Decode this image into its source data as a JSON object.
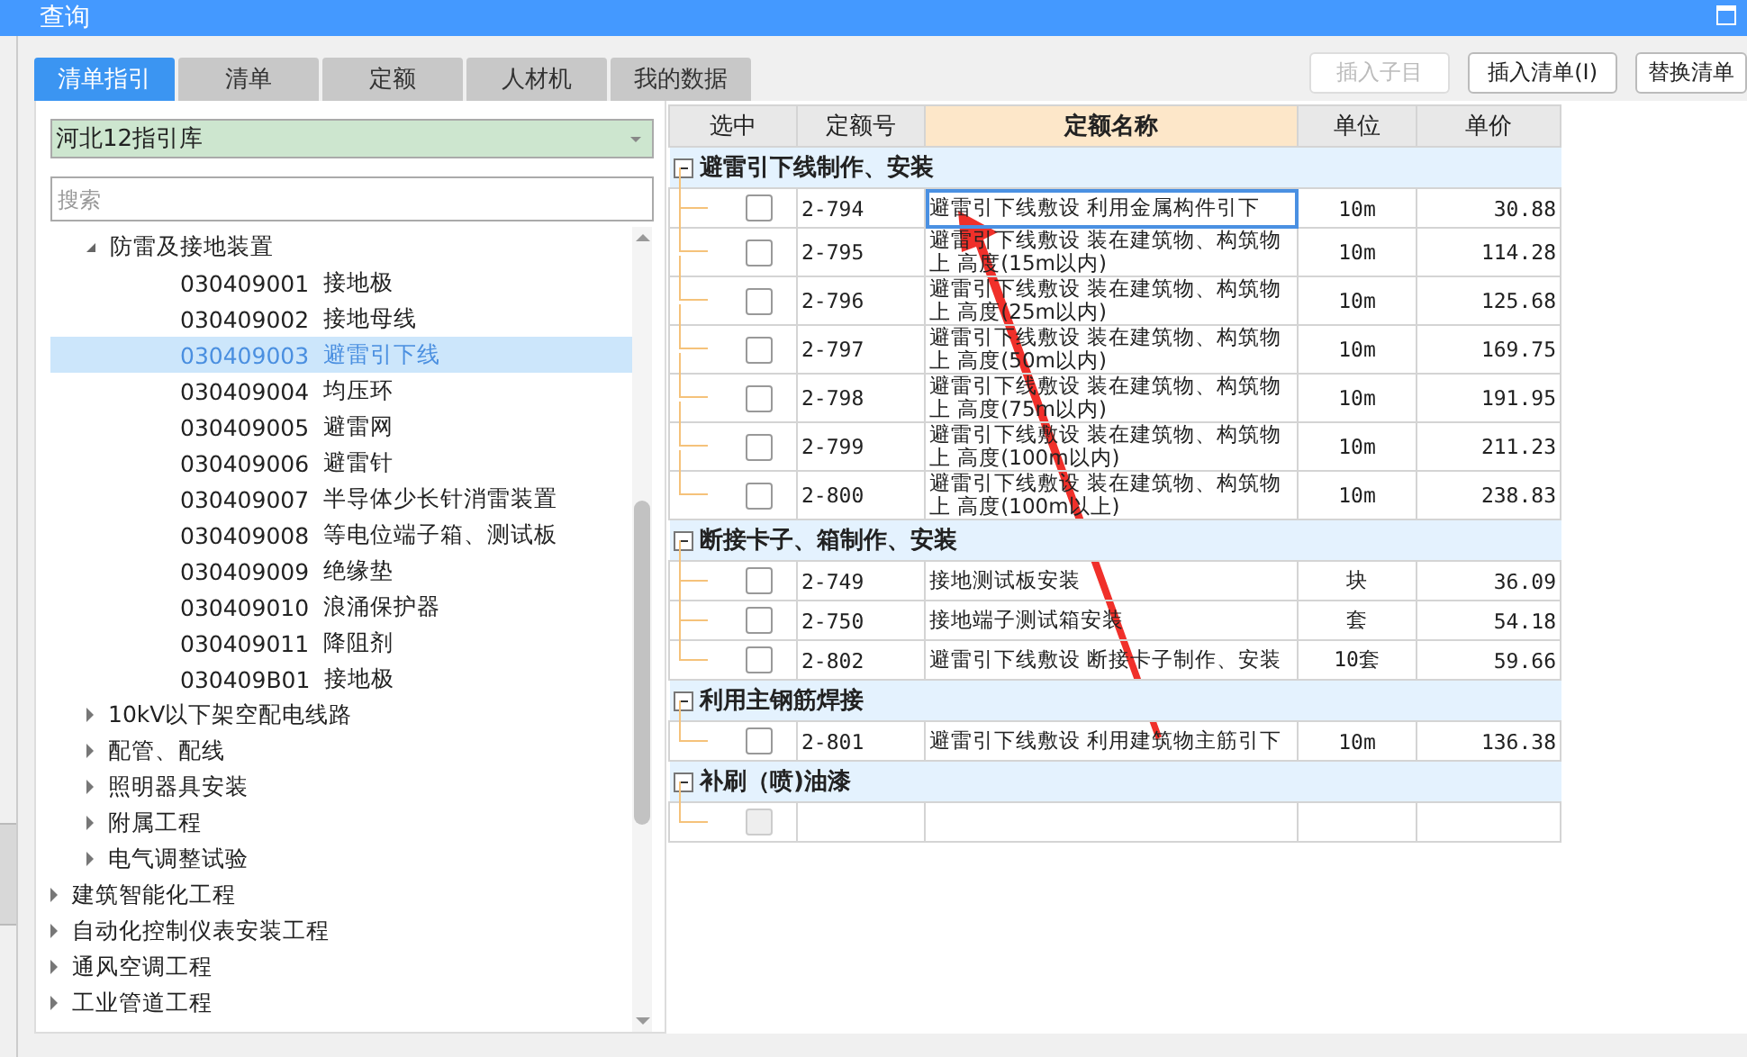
{
  "window": {
    "title": "查询"
  },
  "tabs": [
    {
      "label": "清单指引",
      "selected": true
    },
    {
      "label": "清单",
      "selected": false
    },
    {
      "label": "定额",
      "selected": false
    },
    {
      "label": "人材机",
      "selected": false
    },
    {
      "label": "我的数据",
      "selected": false
    }
  ],
  "buttons": [
    {
      "label": "插入子目",
      "disabled": true
    },
    {
      "label": "插入清单(I)",
      "disabled": false
    },
    {
      "label": "替换清单",
      "disabled": false
    }
  ],
  "library_select": {
    "value": "河北12指引库"
  },
  "search": {
    "placeholder": "搜索"
  },
  "tree": {
    "items": [
      {
        "children": [
          {
            "label": "防雷及接地装置",
            "expanded": true,
            "children": [
              {
                "code": "030409001",
                "label": "接地极",
                "selected": false
              },
              {
                "code": "030409002",
                "label": "接地母线",
                "selected": false
              },
              {
                "code": "030409003",
                "label": "避雷引下线",
                "selected": true
              },
              {
                "code": "030409004",
                "label": "均压环",
                "selected": false
              },
              {
                "code": "030409005",
                "label": "避雷网",
                "selected": false
              },
              {
                "code": "030409006",
                "label": "避雷针",
                "selected": false
              },
              {
                "code": "030409007",
                "label": "半导体少长针消雷装置",
                "selected": false
              },
              {
                "code": "030409008",
                "label": "等电位端子箱、测试板",
                "selected": false
              },
              {
                "code": "030409009",
                "label": "绝缘垫",
                "selected": false
              },
              {
                "code": "030409010",
                "label": "浪涌保护器",
                "selected": false
              },
              {
                "code": "030409011",
                "label": "降阻剂",
                "selected": false
              },
              {
                "code": "030409B01",
                "label": "接地极",
                "selected": false
              }
            ]
          },
          {
            "label": "10kV以下架空配电线路",
            "expanded": false
          },
          {
            "label": "配管、配线",
            "expanded": false
          },
          {
            "label": "照明器具安装",
            "expanded": false
          },
          {
            "label": "附属工程",
            "expanded": false
          },
          {
            "label": "电气调整试验",
            "expanded": false
          }
        ]
      },
      {
        "label": "建筑智能化工程",
        "expanded": false
      },
      {
        "label": "自动化控制仪表安装工程",
        "expanded": false
      },
      {
        "label": "通风空调工程",
        "expanded": false
      },
      {
        "label": "工业管道工程",
        "expanded": false
      }
    ]
  },
  "table": {
    "columns": [
      {
        "label": "选中",
        "selected": false
      },
      {
        "label": "定额号",
        "selected": false
      },
      {
        "label": "定额名称",
        "selected": true
      },
      {
        "label": "单位",
        "selected": false
      },
      {
        "label": "单价",
        "selected": false
      }
    ],
    "groups": [
      {
        "title": "避雷引下线制作、安装",
        "expanded": true,
        "rows": [
          {
            "checked": false,
            "disabled": false,
            "selected": true,
            "code": "2-794",
            "name": "避雷引下线敷设 利用金属构件引下",
            "unit": "10m",
            "price": "30.88"
          },
          {
            "checked": false,
            "disabled": false,
            "selected": false,
            "code": "2-795",
            "name": "避雷引下线敷设 装在建筑物、构筑物上 高度(15m以内)",
            "unit": "10m",
            "price": "114.28"
          },
          {
            "checked": false,
            "disabled": false,
            "selected": false,
            "code": "2-796",
            "name": "避雷引下线敷设 装在建筑物、构筑物上 高度(25m以内)",
            "unit": "10m",
            "price": "125.68"
          },
          {
            "checked": false,
            "disabled": false,
            "selected": false,
            "code": "2-797",
            "name": "避雷引下线敷设 装在建筑物、构筑物上 高度(50m以内)",
            "unit": "10m",
            "price": "169.75"
          },
          {
            "checked": false,
            "disabled": false,
            "selected": false,
            "code": "2-798",
            "name": "避雷引下线敷设 装在建筑物、构筑物上 高度(75m以内)",
            "unit": "10m",
            "price": "191.95"
          },
          {
            "checked": false,
            "disabled": false,
            "selected": false,
            "code": "2-799",
            "name": "避雷引下线敷设 装在建筑物、构筑物上 高度(100m以内)",
            "unit": "10m",
            "price": "211.23"
          },
          {
            "checked": false,
            "disabled": false,
            "selected": false,
            "code": "2-800",
            "name": "避雷引下线敷设 装在建筑物、构筑物上 高度(100m以上)",
            "unit": "10m",
            "price": "238.83"
          }
        ]
      },
      {
        "title": "断接卡子、箱制作、安装",
        "expanded": true,
        "rows": [
          {
            "checked": false,
            "disabled": false,
            "selected": false,
            "code": "2-749",
            "name": "接地测试板安装",
            "unit": "块",
            "price": "36.09"
          },
          {
            "checked": false,
            "disabled": false,
            "selected": false,
            "code": "2-750",
            "name": "接地端子测试箱安装",
            "unit": "套",
            "price": "54.18"
          },
          {
            "checked": false,
            "disabled": false,
            "selected": false,
            "code": "2-802",
            "name": "避雷引下线敷设 断接卡子制作、安装",
            "unit": "10套",
            "price": "59.66"
          }
        ]
      },
      {
        "title": "利用主钢筋焊接",
        "expanded": true,
        "rows": [
          {
            "checked": false,
            "disabled": false,
            "selected": false,
            "code": "2-801",
            "name": "避雷引下线敷设 利用建筑物主筋引下",
            "unit": "10m",
            "price": "136.38"
          }
        ]
      },
      {
        "title": "补刷（喷)油漆",
        "expanded": true,
        "rows": [
          {
            "checked": false,
            "disabled": true,
            "selected": false
          }
        ]
      }
    ]
  }
}
